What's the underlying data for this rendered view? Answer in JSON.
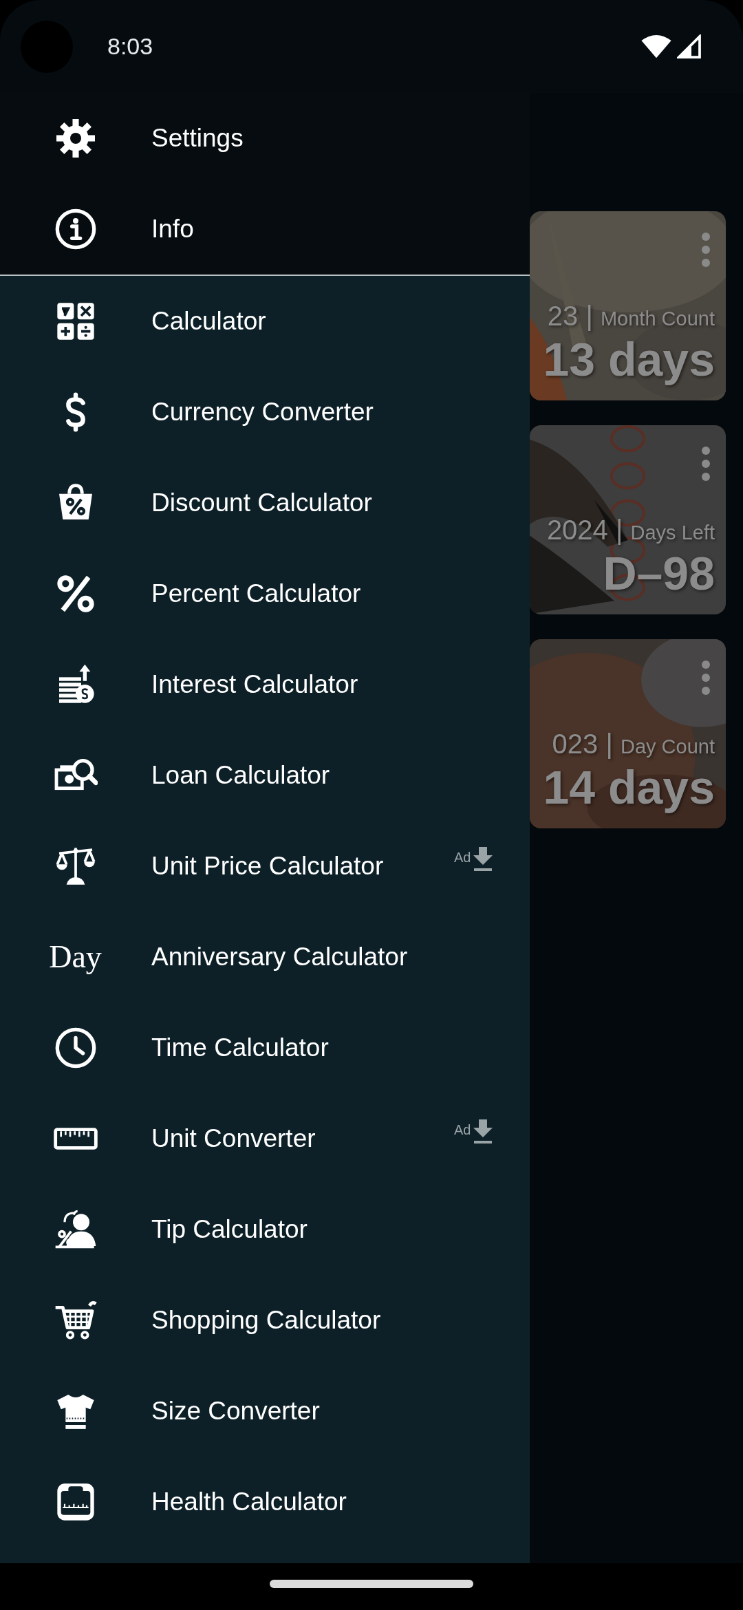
{
  "status_bar": {
    "time": "8:03"
  },
  "cards": [
    {
      "date": "23",
      "separator": "|",
      "label": "Month Count",
      "value": "13 days"
    },
    {
      "date": "2024",
      "separator": "|",
      "label": "Days Left",
      "value": "D–98"
    },
    {
      "date": "023",
      "separator": "|",
      "label": "Day Count",
      "value": "14 days"
    }
  ],
  "drawer": {
    "header_items": [
      {
        "label": "Settings"
      },
      {
        "label": "Info"
      }
    ],
    "items": [
      {
        "label": "Calculator"
      },
      {
        "label": "Currency Converter"
      },
      {
        "label": "Discount Calculator"
      },
      {
        "label": "Percent Calculator"
      },
      {
        "label": "Interest Calculator"
      },
      {
        "label": "Loan Calculator"
      },
      {
        "label": "Unit Price Calculator",
        "ad_badge": "Ad"
      },
      {
        "label": "Anniversary Calculator",
        "icon_text": "Day"
      },
      {
        "label": "Time Calculator"
      },
      {
        "label": "Unit Converter",
        "ad_badge": "Ad"
      },
      {
        "label": "Tip Calculator"
      },
      {
        "label": "Shopping Calculator"
      },
      {
        "label": "Size Converter"
      },
      {
        "label": "Health Calculator"
      }
    ]
  }
}
